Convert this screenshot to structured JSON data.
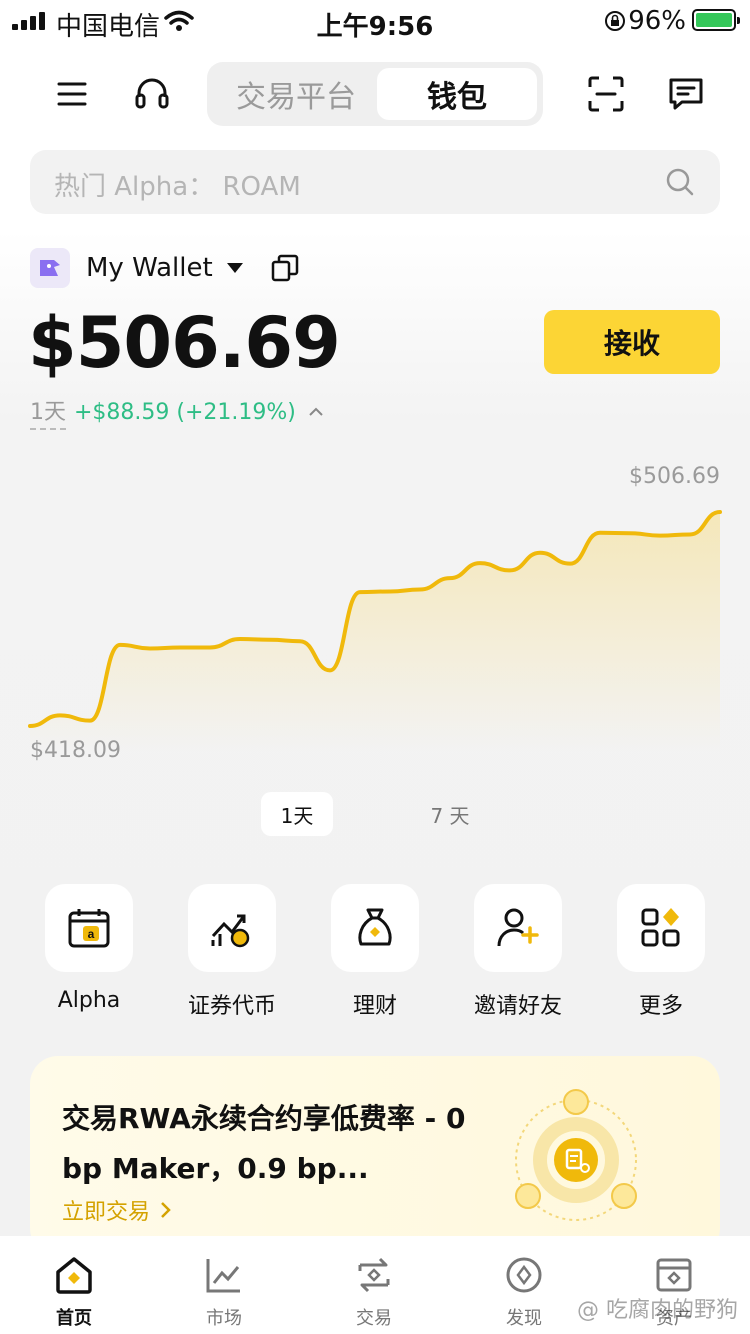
{
  "status": {
    "carrier": "中国电信",
    "time": "上午9:56",
    "battery": "96%"
  },
  "header": {
    "tabs": [
      {
        "label": "交易平台"
      },
      {
        "label": "钱包"
      }
    ]
  },
  "search": {
    "placeholder": "热门 Alpha： ROAM"
  },
  "wallet": {
    "name": "My Wallet",
    "balance": "$506.69",
    "receive_label": "接收",
    "period": "1天",
    "change": "+$88.59 (+21.19%)"
  },
  "chart_data": {
    "type": "area",
    "max_label": "$506.69",
    "min_label": "$418.09",
    "ylim": [
      418.09,
      506.69
    ],
    "values": [
      418.1,
      422.5,
      420.3,
      451.7,
      450.2,
      450.6,
      450.6,
      454.1,
      453.8,
      453.2,
      441.1,
      473.5,
      473.8,
      474.6,
      479.3,
      485.5,
      482.5,
      489.8,
      485.3,
      498.1,
      497.9,
      496.9,
      497.4,
      506.7
    ],
    "color": "#f0b90b",
    "fill": "#f7ecc4"
  },
  "ranges": [
    {
      "label": "1天"
    },
    {
      "label": "7 天"
    }
  ],
  "quick_actions": [
    {
      "label": "Alpha",
      "icon": "alpha-calendar-icon"
    },
    {
      "label": "证券代币",
      "icon": "stock-token-icon"
    },
    {
      "label": "理财",
      "icon": "money-bag-icon"
    },
    {
      "label": "邀请好友",
      "icon": "invite-friend-icon"
    },
    {
      "label": "更多",
      "icon": "more-grid-icon"
    }
  ],
  "promo": {
    "title": "交易RWA永续合约享低费率 - 0 bp Maker，0.9 bp...",
    "cta": "立即交易"
  },
  "tabbar": [
    {
      "label": "首页",
      "icon": "home-icon"
    },
    {
      "label": "市场",
      "icon": "market-chart-icon"
    },
    {
      "label": "交易",
      "icon": "trade-swap-icon"
    },
    {
      "label": "发现",
      "icon": "discover-compass-icon"
    },
    {
      "label": "资产",
      "icon": "wallet-assets-icon"
    }
  ],
  "watermark": "@ 吃腐肉的野狗",
  "colors": {
    "accent": "#fcd535",
    "positive": "#2ebd85",
    "chart_line": "#f0b90b"
  }
}
